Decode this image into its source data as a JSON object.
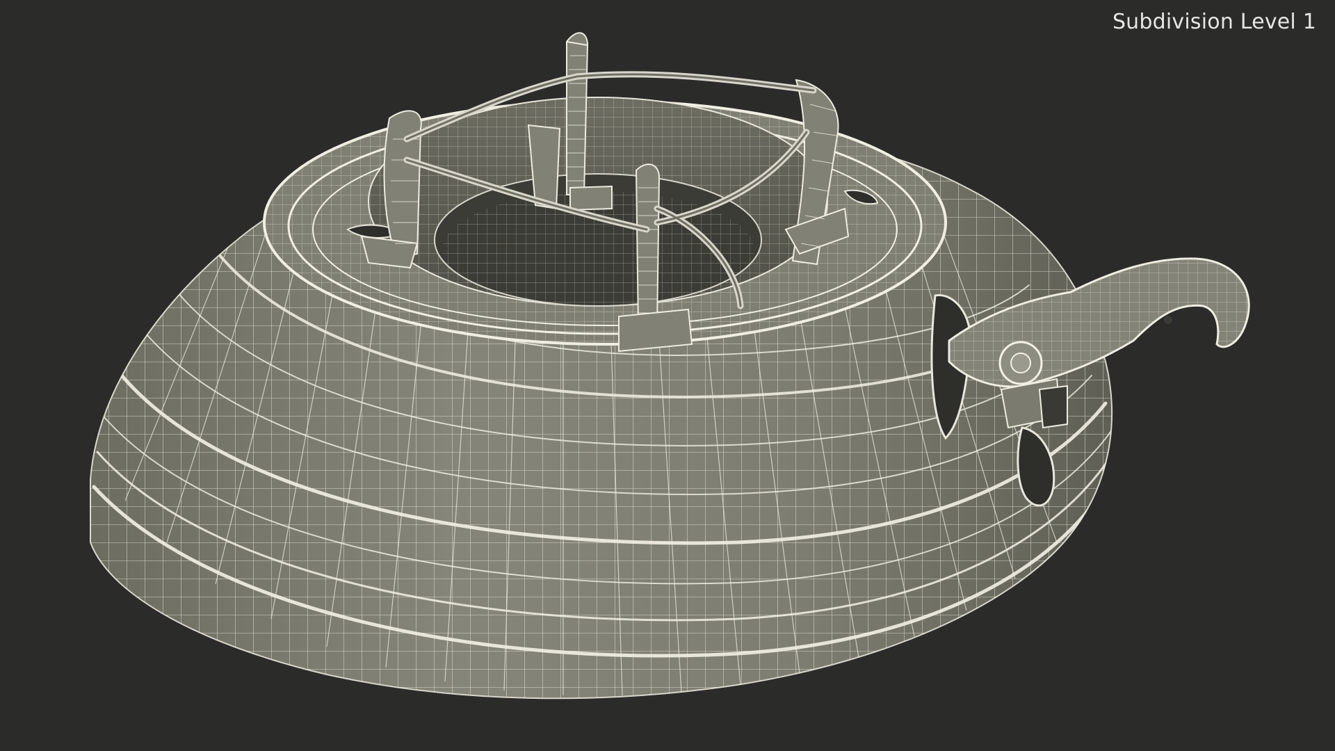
{
  "viewport": {
    "subdivision_label": "Subdivision Level 1",
    "background_color": "#2b2b2a"
  },
  "model": {
    "surface_color": "#7b7b6f",
    "wire_color": "#e9e7dc",
    "shadow_color": "#4a4a42",
    "display_mode": "wireframe-on-shaded"
  }
}
